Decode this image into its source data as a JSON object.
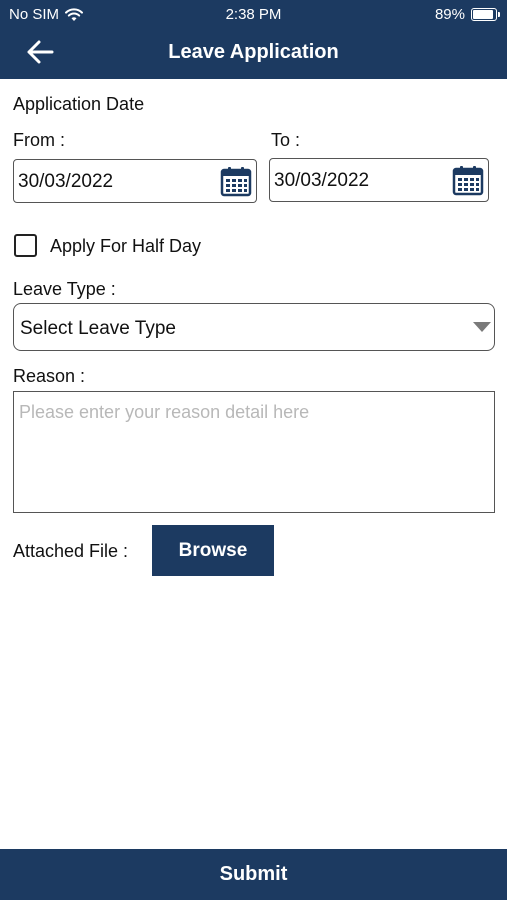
{
  "status_bar": {
    "carrier": "No SIM",
    "time": "2:38 PM",
    "battery_percent": "89%",
    "battery_level": 0.89
  },
  "header": {
    "back_icon": "arrow-left-icon",
    "title": "Leave Application"
  },
  "form": {
    "application_date_label": "Application Date",
    "from_label": "From :",
    "from_value": "30/03/2022",
    "to_label": "To :",
    "to_value": "30/03/2022",
    "calendar_icon": "calendar-icon",
    "half_day_label": "Apply For Half Day",
    "half_day_checked": false,
    "leave_type_label": "Leave Type :",
    "leave_type_value": "Select Leave Type",
    "reason_label": "Reason :",
    "reason_placeholder": "Please enter your reason detail here",
    "reason_value": "",
    "attached_file_label": "Attached File :",
    "browse_label": "Browse"
  },
  "footer": {
    "submit_label": "Submit"
  },
  "colors": {
    "primary": "#1c3a61",
    "background": "#ffffff",
    "placeholder": "#b8b8b8"
  }
}
